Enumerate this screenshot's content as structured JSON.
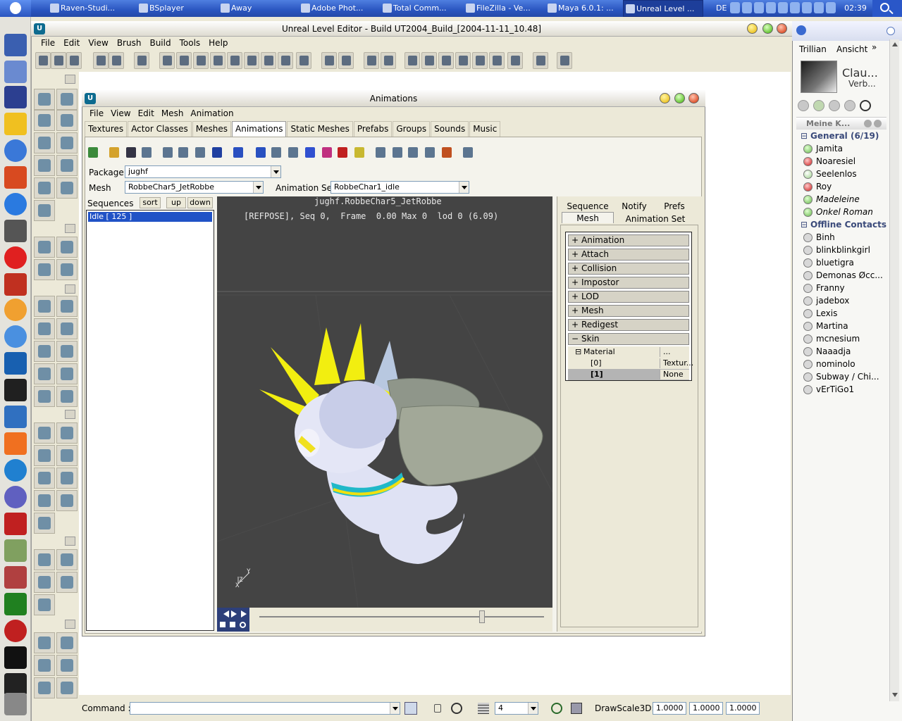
{
  "taskbar": {
    "items": [
      "Raven-Studi...",
      "BSplayer",
      "Away",
      "Adobe Phot...",
      "Total Comm...",
      "FileZilla - Ve...",
      "Maya 6.0.1: ...",
      "Unreal Level ..."
    ],
    "active_index": 7,
    "clock": "02:39",
    "lang": "DE"
  },
  "editor": {
    "title": "Unreal Level Editor - Build UT2004_Build_[2004-11-11_10.48]",
    "menu": [
      "File",
      "Edit",
      "View",
      "Brush",
      "Build",
      "Tools",
      "Help"
    ]
  },
  "animations": {
    "title": "Animations",
    "menu": [
      "File",
      "View",
      "Edit",
      "Mesh",
      "Animation"
    ],
    "tabs": [
      "Textures",
      "Actor Classes",
      "Meshes",
      "Animations",
      "Static Meshes",
      "Prefabs",
      "Groups",
      "Sounds",
      "Music"
    ],
    "selected_tab": "Animations",
    "package_label": "Package",
    "package_value": "jughf",
    "mesh_label": "Mesh",
    "mesh_value": "RobbeChar5_JetRobbe",
    "animset_label": "Animation Set",
    "animset_value": "RobbeChar1_idle",
    "sequences_label": "Sequences",
    "sort_label": "sort",
    "up_label": "up",
    "down_label": "down",
    "sequences": [
      "Idle [ 125 ]"
    ],
    "viewport_line1": "jughf.RobbeChar5_JetRobbe",
    "viewport_line2": "[REFPOSE], Seq 0,  Frame  0.00 Max 0  lod 0 (6.09)",
    "axis_y": "Y",
    "axis_z": "Z",
    "axis_x": "X",
    "right_tabs": {
      "sequence": "Sequence",
      "notify": "Notify",
      "prefs": "Prefs",
      "mesh": "Mesh",
      "animset": "Animation Set"
    },
    "props": [
      "Animation",
      "Attach",
      "Collision",
      "Impostor",
      "LOD",
      "Mesh",
      "Redigest",
      "Skin"
    ],
    "material_label": "Material",
    "material_value": "...",
    "material_0_index": "[0]",
    "material_0_value": "Textur...",
    "material_1_index": "[1]",
    "material_1_value": "None"
  },
  "command": {
    "label": "Command :",
    "value": "",
    "grid_value": "4",
    "drawscale_label": "DrawScale3D:",
    "drawscale": [
      "1.0000",
      "1.0000",
      "1.0000"
    ]
  },
  "trillian": {
    "menu_a": "Trillian",
    "menu_b": "Ansicht",
    "menu_more": "»",
    "name": "Clau...",
    "status": "Verb...",
    "contacts_header": "Meine K...",
    "group1": "General (6/19)",
    "online": [
      {
        "name": "Jamita",
        "state": "on",
        "italic": false
      },
      {
        "name": "Noaresiel",
        "state": "dn",
        "italic": false
      },
      {
        "name": "Seelenlos",
        "state": "aw",
        "italic": false
      },
      {
        "name": "Roy",
        "state": "dn",
        "italic": false
      },
      {
        "name": "Madeleine",
        "state": "on",
        "italic": true
      },
      {
        "name": "Onkel Roman",
        "state": "on",
        "italic": true
      }
    ],
    "group2": "Offline Contacts",
    "offline": [
      "Binh",
      "blinkblinkgirl",
      "bluetigra",
      "Demonas Øcc...",
      "Franny",
      "jadebox",
      "Lexis",
      "Martina",
      "mcnesium",
      "Naaadja",
      "nominolo",
      "Subway / Chi...",
      "vErTiGo1"
    ]
  }
}
